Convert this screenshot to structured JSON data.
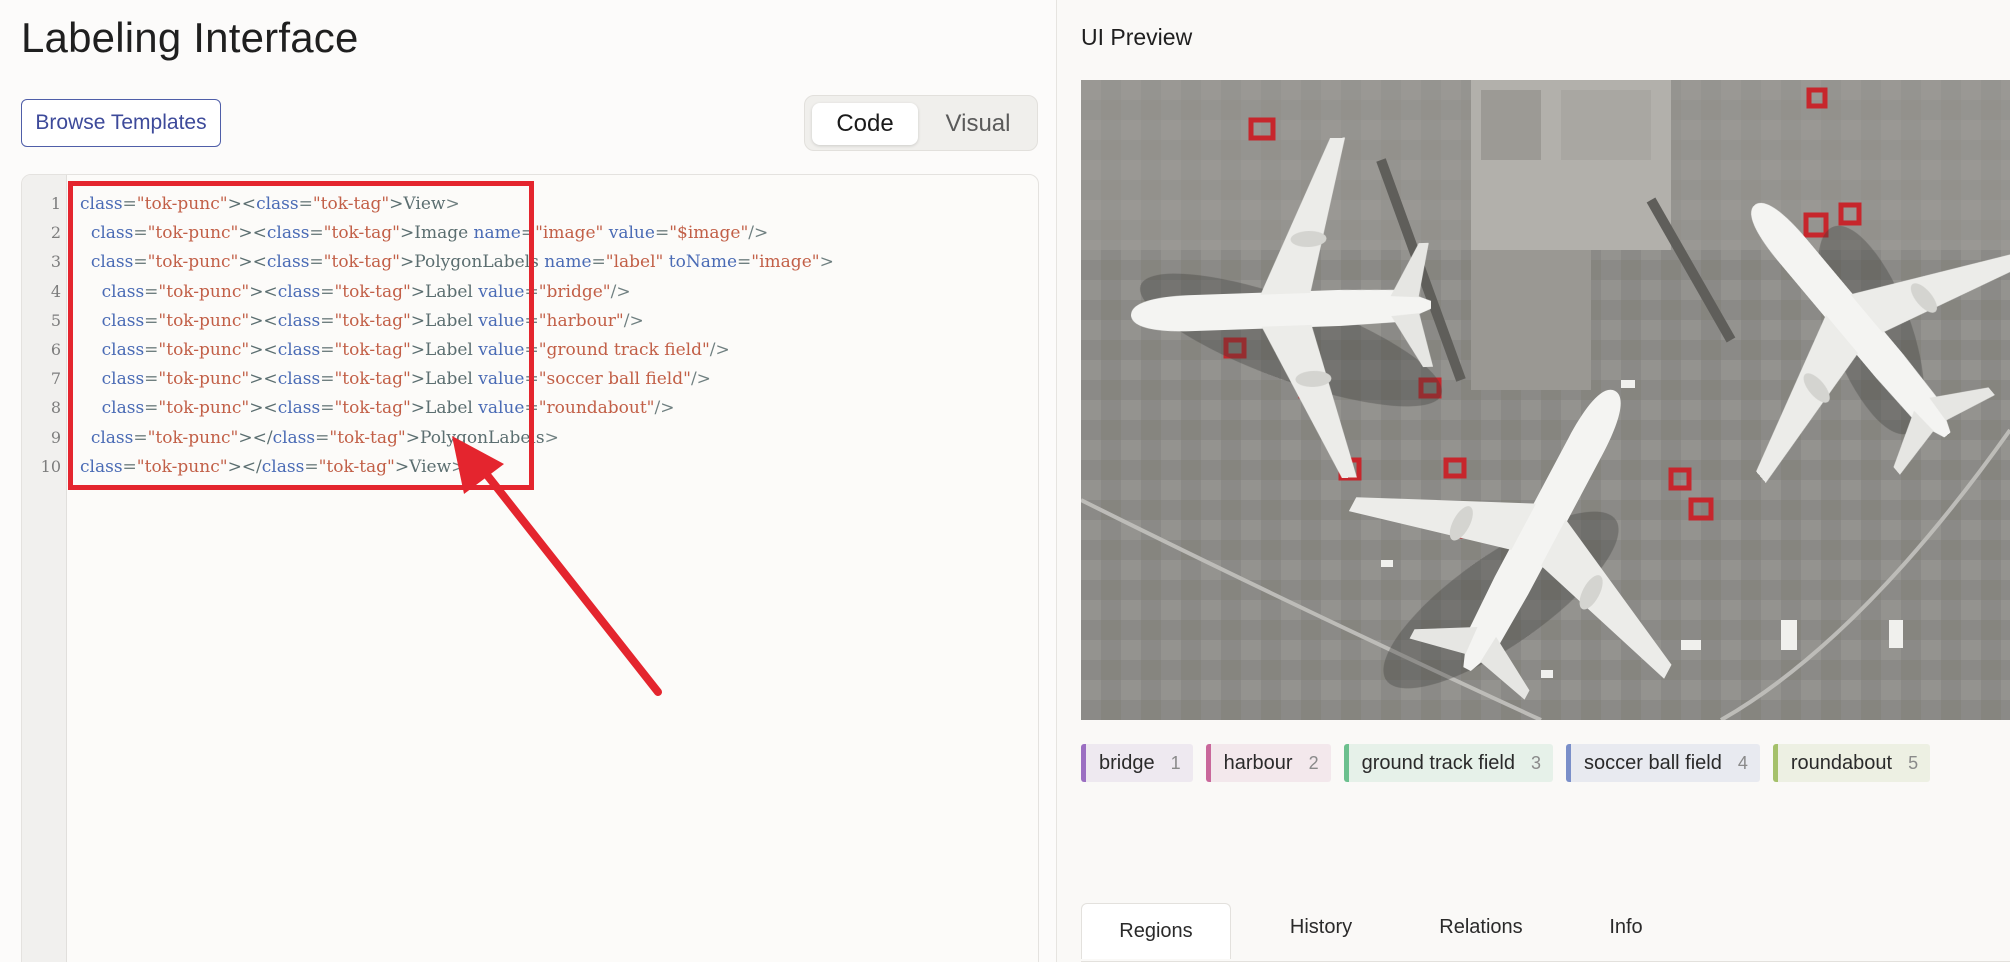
{
  "editor_panel": {
    "title": "Labeling Interface",
    "browse_button": "Browse Templates",
    "toggle": {
      "code": "Code",
      "visual": "Visual",
      "selected": "Code"
    },
    "line_numbers": [
      "1",
      "2",
      "3",
      "4",
      "5",
      "6",
      "7",
      "8",
      "9",
      "10"
    ],
    "code_lines": [
      "<View>",
      "  <Image name=\"image\" value=\"$image\"/>",
      "  <PolygonLabels name=\"label\" toName=\"image\">",
      "    <Label value=\"bridge\"/>",
      "    <Label value=\"harbour\"/>",
      "    <Label value=\"ground track field\"/>",
      "    <Label value=\"soccer ball field\"/>",
      "    <Label value=\"roundabout\"/>",
      "  </PolygonLabels>",
      "</View>"
    ]
  },
  "annotation": {
    "highlight_color": "#e4252e"
  },
  "preview_panel": {
    "title": "UI Preview",
    "labels": [
      {
        "name": "bridge",
        "hotkey": "1",
        "color": "#9b6fc2",
        "bg": "#eee9f0"
      },
      {
        "name": "harbour",
        "hotkey": "2",
        "color": "#c9689b",
        "bg": "#f3e8ec"
      },
      {
        "name": "ground track field",
        "hotkey": "3",
        "color": "#6cc08e",
        "bg": "#e6f1e9"
      },
      {
        "name": "soccer ball field",
        "hotkey": "4",
        "color": "#7a8fc9",
        "bg": "#e8eaf0"
      },
      {
        "name": "roundabout",
        "hotkey": "5",
        "color": "#a5c16b",
        "bg": "#edf0e3"
      }
    ],
    "tabs": [
      "Regions",
      "History",
      "Relations",
      "Info"
    ],
    "active_tab": "Regions"
  }
}
